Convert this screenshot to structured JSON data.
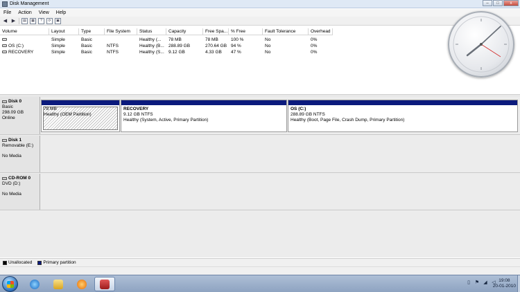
{
  "window": {
    "title": "Disk Management",
    "buttons": [
      "–",
      "□",
      "x"
    ]
  },
  "menu": [
    "File",
    "Action",
    "View",
    "Help"
  ],
  "toolbar": {
    "icons": [
      "back-arrow-icon",
      "forward-arrow-icon",
      "console-tree-icon",
      "properties-icon",
      "help-icon",
      "refresh-icon",
      "disk-icon"
    ]
  },
  "volume_list": {
    "columns": [
      "Volume",
      "Layout",
      "Type",
      "File System",
      "Status",
      "Capacity",
      "Free Spa...",
      "% Free",
      "Fault Tolerance",
      "Overhead"
    ],
    "rows": [
      [
        "",
        "Simple",
        "Basic",
        "",
        "Healthy (...",
        "78 MB",
        "78 MB",
        "100 %",
        "No",
        "0%"
      ],
      [
        "OS (C:)",
        "Simple",
        "Basic",
        "NTFS",
        "Healthy (B...",
        "288.89 GB",
        "270.64 GB",
        "94 %",
        "No",
        "0%"
      ],
      [
        "RECOVERY",
        "Simple",
        "Basic",
        "NTFS",
        "Healthy (S...",
        "9.12 GB",
        "4.33 GB",
        "47 %",
        "No",
        "0%"
      ]
    ]
  },
  "disks": [
    {
      "name": "Disk 0",
      "lines": [
        "Basic",
        "298.09 GB",
        "Online"
      ],
      "partitions": [
        {
          "name": "",
          "size": "78 MB",
          "status": "Healthy (OEM Partition)"
        },
        {
          "name": "RECOVERY",
          "size": "9.12 GB NTFS",
          "status": "Healthy (System, Active, Primary Partition)"
        },
        {
          "name": "OS  (C:)",
          "size": "288.89 GB NTFS",
          "status": "Healthy (Boot, Page File, Crash Dump, Primary Partition)"
        }
      ]
    },
    {
      "name": "Disk 1",
      "lines": [
        "Removable (E:)",
        "",
        "No Media"
      ]
    },
    {
      "name": "CD-ROM 0",
      "lines": [
        "DVD (D:)",
        "",
        "No Media"
      ]
    }
  ],
  "legend": [
    {
      "label": "Unallocated",
      "color": "#000000"
    },
    {
      "label": "Primary partition",
      "color": "#0b1a7d"
    }
  ],
  "taskbar": {
    "apps": [
      "internet-explorer-icon",
      "windows-explorer-icon",
      "media-player-icon",
      "disk-management-icon"
    ],
    "time": "19:08",
    "date": "20-01-2010"
  }
}
